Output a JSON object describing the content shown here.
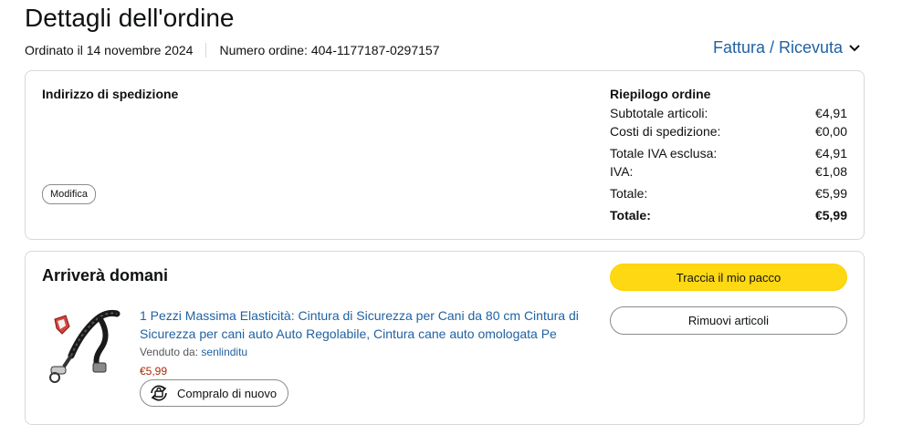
{
  "page": {
    "title": "Dettagli dell'ordine"
  },
  "order": {
    "date": "Ordinato il 14 novembre 2024",
    "number": "Numero ordine: 404-1177187-0297157",
    "invoice_label": "Fattura / Ricevuta"
  },
  "shipping": {
    "title": "Indirizzo di spedizione",
    "edit_label": "Modifica"
  },
  "summary": {
    "title": "Riepilogo ordine",
    "rows": [
      {
        "label": "Subtotale articoli:",
        "value": "€4,91"
      },
      {
        "label": "Costi di spedizione:",
        "value": "€0,00"
      },
      {
        "label": "Totale IVA esclusa:",
        "value": "€4,91"
      },
      {
        "label": "IVA:",
        "value": "€1,08"
      },
      {
        "label": "Totale:",
        "value": "€5,99"
      },
      {
        "label": "Totale:",
        "value": "€5,99"
      }
    ]
  },
  "delivery": {
    "status": "Arriverà domani",
    "track_label": "Traccia il mio pacco",
    "remove_label": "Rimuovi articoli"
  },
  "item": {
    "title": "1 Pezzi Massima Elasticità: Cintura di Sicurezza per Cani da 80 cm Cintura di Sicurezza per cani auto Auto Regolabile, Cintura cane auto omologata Pe",
    "sold_by_label": "Venduto da:",
    "seller": "senlinditu",
    "price": "€5,99",
    "buy_again_label": "Compralo di nuovo",
    "image_icon": "dog-seat-belt-product-image"
  },
  "colors": {
    "link": "#2162a1",
    "price": "#b12704",
    "primary_button": "#ffd814"
  }
}
